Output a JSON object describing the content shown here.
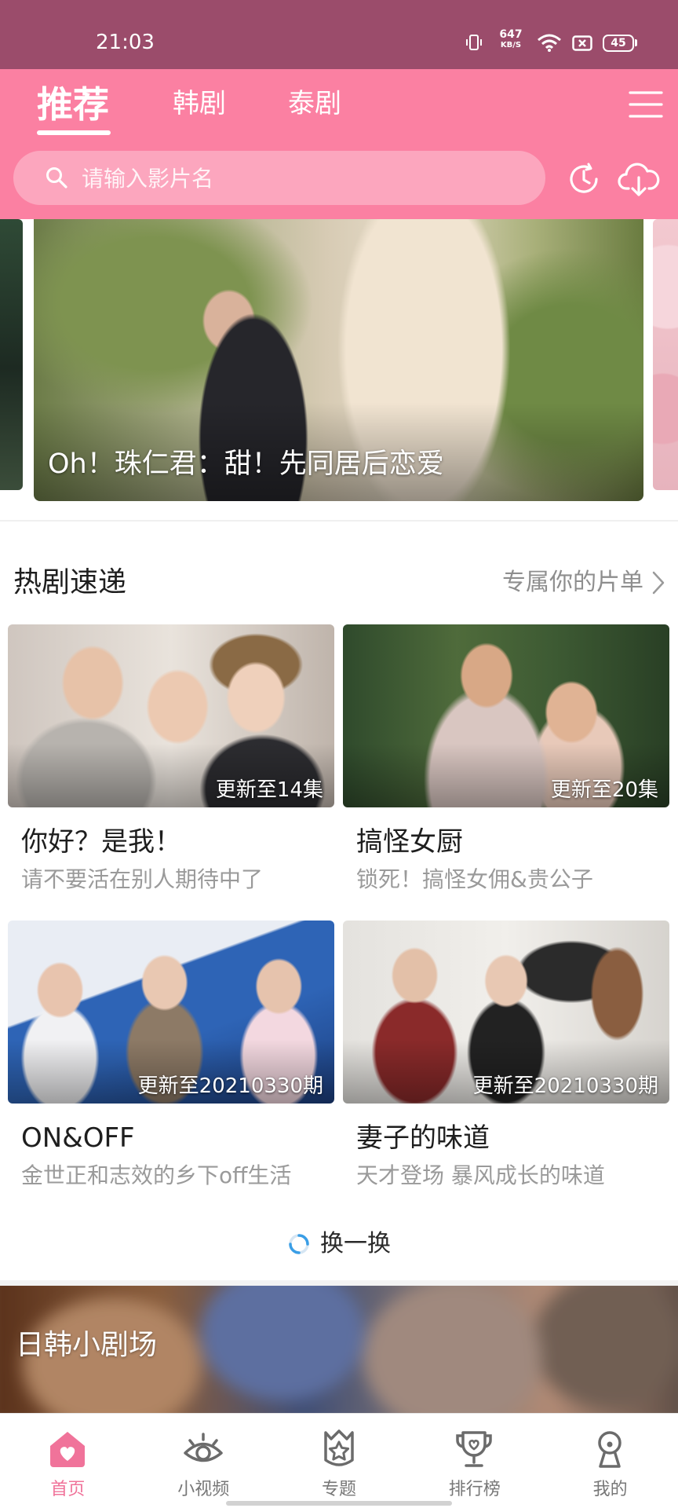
{
  "theme": {
    "status_bar_color": "#9b4c6b",
    "header_color": "#fb80a2",
    "accent_color": "#f0739a"
  },
  "status_bar": {
    "time": "21:03",
    "net_speed": "647",
    "net_speed_unit": "KB/S",
    "battery_level": "45",
    "icons": [
      "vibrate-icon",
      "wifi-icon",
      "sim-disabled-icon",
      "battery-icon"
    ]
  },
  "header": {
    "tabs": [
      {
        "label": "推荐",
        "active": true
      },
      {
        "label": "韩剧",
        "active": false
      },
      {
        "label": "泰剧",
        "active": false
      }
    ],
    "menu_icon": "menu-icon"
  },
  "search": {
    "placeholder": "请输入影片名",
    "icon": "search-icon",
    "actions": [
      "history-icon",
      "download-icon"
    ]
  },
  "banner": {
    "title": "Oh！珠仁君：甜！先同居后恋爱"
  },
  "hot_dramas": {
    "title": "热剧速递",
    "more_label": "专属你的片单",
    "refresh_label": "换一换",
    "items": [
      {
        "badge": "更新至14集",
        "title": "你好？是我！",
        "subtitle": "请不要活在别人期待中了"
      },
      {
        "badge": "更新至20集",
        "title": "搞怪女厨",
        "subtitle": "锁死！搞怪女佣&贵公子"
      },
      {
        "badge": "更新至20210330期",
        "title": "ON&OFF",
        "subtitle": "金世正和志效的乡下off生活"
      },
      {
        "badge": "更新至20210330期",
        "title": "妻子的味道",
        "subtitle": "天才登场 暴风成长的味道"
      }
    ]
  },
  "mini_theater": {
    "title": "日韩小剧场"
  },
  "bottom_nav": {
    "items": [
      {
        "label": "首页",
        "icon": "home-icon",
        "active": true
      },
      {
        "label": "小视频",
        "icon": "eye-icon",
        "active": false
      },
      {
        "label": "专题",
        "icon": "star-badge-icon",
        "active": false
      },
      {
        "label": "排行榜",
        "icon": "trophy-icon",
        "active": false
      },
      {
        "label": "我的",
        "icon": "profile-icon",
        "active": false
      }
    ]
  }
}
